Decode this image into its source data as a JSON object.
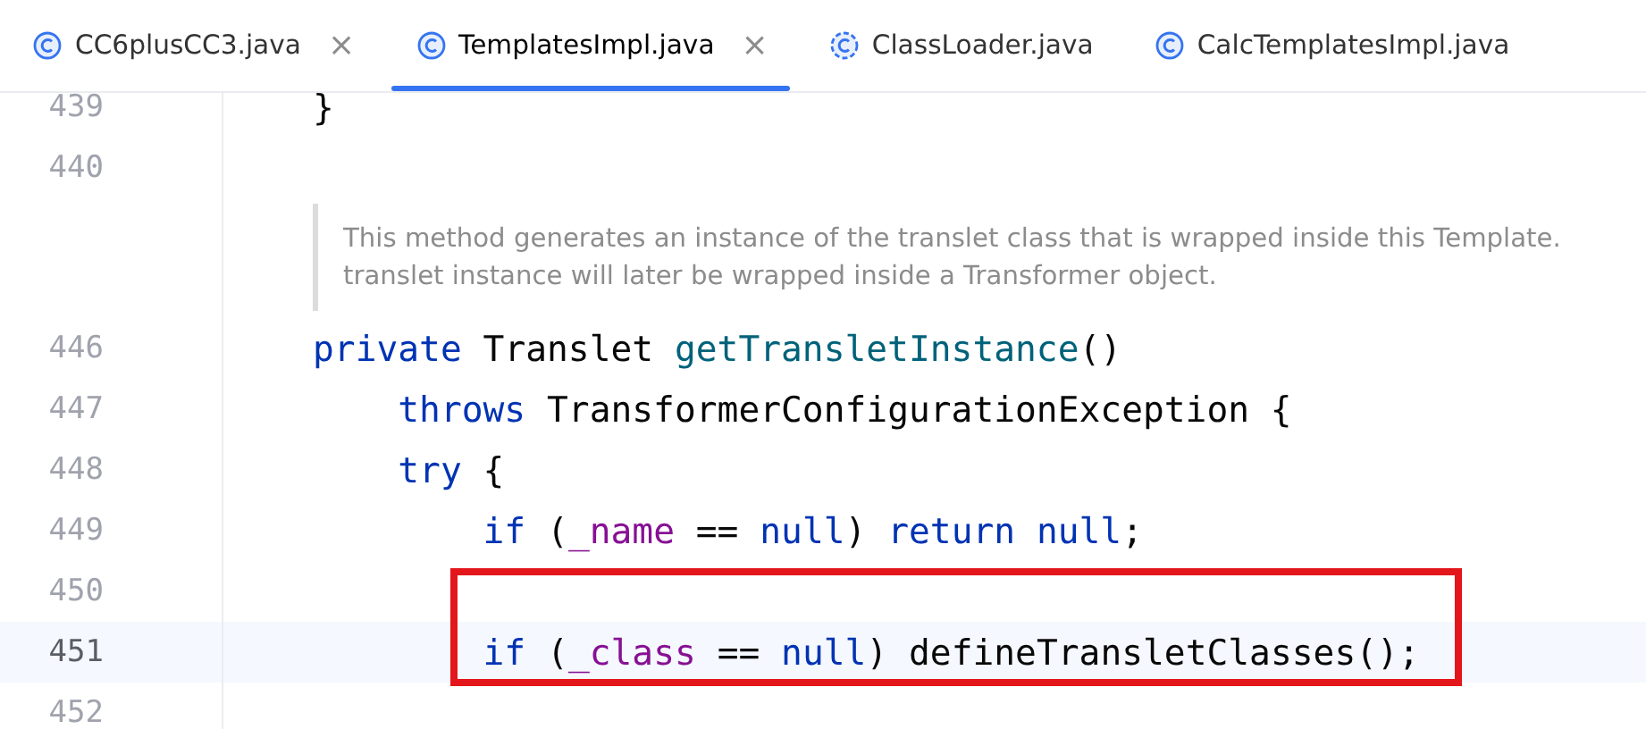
{
  "tabs": [
    {
      "label": "CC6plusCC3.java",
      "kind": "class",
      "selected": false,
      "closable": true
    },
    {
      "label": "TemplatesImpl.java",
      "kind": "class",
      "selected": true,
      "closable": true
    },
    {
      "label": "ClassLoader.java",
      "kind": "library-class",
      "selected": false,
      "closable": false
    },
    {
      "label": "CalcTemplatesImpl.java",
      "kind": "class",
      "selected": false,
      "closable": false
    }
  ],
  "close_glyph": "×",
  "editor": {
    "rows": [
      {
        "kind": "code",
        "number": "439",
        "current": false,
        "boxed": false,
        "tokens": [
          {
            "text": "}",
            "kind": "plain"
          }
        ]
      },
      {
        "kind": "code",
        "number": "440",
        "current": false,
        "boxed": false,
        "tokens": []
      },
      {
        "kind": "doc",
        "lines": [
          "This method generates an instance of the translet class that is wrapped inside this Template.",
          "translet instance will later be wrapped inside a Transformer object."
        ]
      },
      {
        "kind": "code",
        "number": "446",
        "current": false,
        "boxed": false,
        "tokens": [
          {
            "text": "private ",
            "kind": "keyword"
          },
          {
            "text": "Translet ",
            "kind": "plain"
          },
          {
            "text": "getTransletInstance",
            "kind": "method"
          },
          {
            "text": "()",
            "kind": "plain"
          }
        ]
      },
      {
        "kind": "code",
        "number": "447",
        "current": false,
        "boxed": false,
        "tokens": [
          {
            "text": "    throws ",
            "kind": "keyword"
          },
          {
            "text": "TransformerConfigurationException {",
            "kind": "plain"
          }
        ]
      },
      {
        "kind": "code",
        "number": "448",
        "current": false,
        "boxed": false,
        "tokens": [
          {
            "text": "    try ",
            "kind": "keyword"
          },
          {
            "text": "{",
            "kind": "plain"
          }
        ]
      },
      {
        "kind": "code",
        "number": "449",
        "current": false,
        "boxed": false,
        "tokens": [
          {
            "text": "        if ",
            "kind": "keyword"
          },
          {
            "text": "(",
            "kind": "plain"
          },
          {
            "text": "_name",
            "kind": "field"
          },
          {
            "text": " == ",
            "kind": "plain"
          },
          {
            "text": "null",
            "kind": "keyword"
          },
          {
            "text": ") ",
            "kind": "plain"
          },
          {
            "text": "return null",
            "kind": "keyword"
          },
          {
            "text": ";",
            "kind": "plain"
          }
        ]
      },
      {
        "kind": "code",
        "number": "450",
        "current": false,
        "boxed": true,
        "tokens": []
      },
      {
        "kind": "code",
        "number": "451",
        "current": true,
        "boxed": true,
        "tokens": [
          {
            "text": "        if ",
            "kind": "keyword"
          },
          {
            "text": "(",
            "kind": "plain"
          },
          {
            "text": "_class",
            "kind": "field"
          },
          {
            "text": " == ",
            "kind": "plain"
          },
          {
            "text": "null",
            "kind": "keyword"
          },
          {
            "text": ") defineTransletClasses();",
            "kind": "plain"
          }
        ]
      },
      {
        "kind": "code",
        "number": "452",
        "current": false,
        "boxed": false,
        "tokens": []
      }
    ]
  }
}
